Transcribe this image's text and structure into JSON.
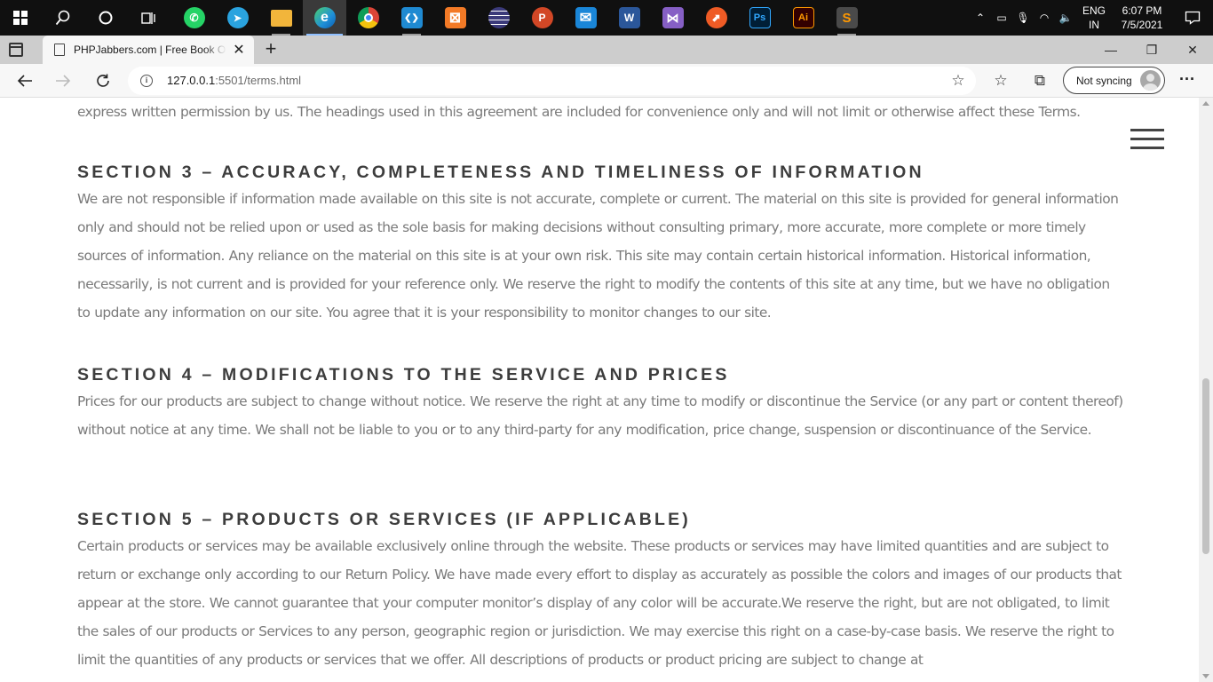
{
  "taskbar": {
    "apps": [
      {
        "name": "WhatsApp",
        "glyph": "✆",
        "color": "#25d366"
      },
      {
        "name": "Telegram",
        "glyph": "➤",
        "color": "#2aa3df"
      },
      {
        "name": "File Explorer",
        "glyph": "",
        "color": "#f2b53b"
      },
      {
        "name": "Microsoft Edge",
        "glyph": "e",
        "color": "#1f8fd8"
      },
      {
        "name": "Google Chrome",
        "glyph": "",
        "color": "#db4437"
      },
      {
        "name": "Visual Studio Code",
        "glyph": "❮❯",
        "color": "#1f8ad2"
      },
      {
        "name": "XAMPP",
        "glyph": "⊠",
        "color": "#f37a26"
      },
      {
        "name": "Eclipse",
        "glyph": "",
        "color": "#3b3a7a"
      },
      {
        "name": "PowerPoint",
        "glyph": "P",
        "color": "#d24726"
      },
      {
        "name": "Mail",
        "glyph": "✉",
        "color": "#1a86d8"
      },
      {
        "name": "Word",
        "glyph": "W",
        "color": "#2b579a"
      },
      {
        "name": "Visual Studio",
        "glyph": "⋈",
        "color": "#865fc5"
      },
      {
        "name": "Postman",
        "glyph": "⬈",
        "color": "#ef5b25"
      },
      {
        "name": "Photoshop",
        "glyph": "Ps",
        "color": "#001e36"
      },
      {
        "name": "Illustrator",
        "glyph": "Ai",
        "color": "#330000"
      },
      {
        "name": "Sublime Text",
        "glyph": "S",
        "color": "#4a4a4a"
      }
    ],
    "tray": {
      "lang_line1": "ENG",
      "lang_line2": "IN",
      "time": "6:07 PM",
      "date": "7/5/2021"
    }
  },
  "browser": {
    "tab_title": "PHPJabbers.com | Free Book Online",
    "url_host": "127.0.0.1",
    "url_rest": ":5501/terms.html",
    "sync_label": "Not syncing"
  },
  "page": {
    "intro_tail": "express written permission by us. The headings used in this agreement are included for convenience only and will not limit or otherwise affect these Terms.",
    "section3": {
      "heading": "SECTION 3 – ACCURACY, COMPLETENESS AND TIMELINESS OF INFORMATION",
      "body": "We are not responsible if information made available on this site is not accurate, complete or current. The material on this site is provided for general information only and should not be relied upon or used as the sole basis for making decisions without consulting primary, more accurate, more complete or more timely sources of information. Any reliance on the material on this site is at your own risk. This site may contain certain historical information. Historical information, necessarily, is not current and is provided for your reference only. We reserve the right to modify the contents of this site at any time, but we have no obligation to update any information on our site. You agree that it is your responsibility to monitor changes to our site."
    },
    "section4": {
      "heading": "SECTION 4 – MODIFICATIONS TO THE SERVICE AND PRICES",
      "body": "Prices for our products are subject to change without notice. We reserve the right at any time to modify or discontinue the Service (or any part or content thereof) without notice at any time. We shall not be liable to you or to any third-party for any modification, price change, suspension or discontinuance of the Service."
    },
    "section5": {
      "heading": "SECTION 5 – PRODUCTS OR SERVICES (IF APPLICABLE)",
      "body": "Certain products or services may be available exclusively online through the website. These products or services may have limited quantities and are subject to return or exchange only according to our Return Policy. We have made every effort to display as accurately as possible the colors and images of our products that appear at the store. We cannot guarantee that your computer monitor’s display of any color will be accurate.We reserve the right, but are not obligated, to limit the sales of our products or Services to any person, geographic region or jurisdiction. We may exercise this right on a case-by-case basis. We reserve the right to limit the quantities of any products or services that we offer. All descriptions of products or product pricing are subject to change at"
    }
  }
}
